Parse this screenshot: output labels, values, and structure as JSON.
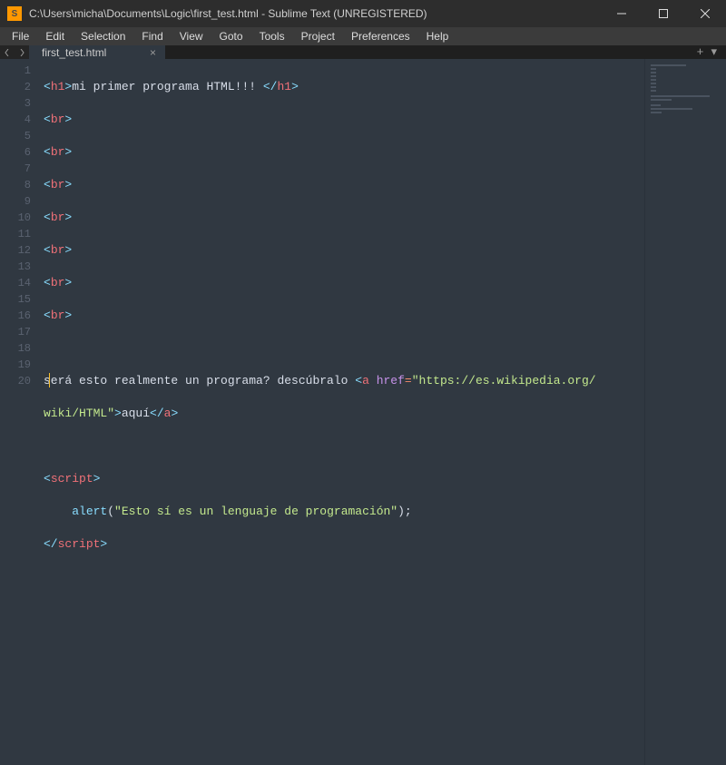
{
  "window": {
    "title": "C:\\Users\\micha\\Documents\\Logic\\first_test.html - Sublime Text (UNREGISTERED)"
  },
  "menu": {
    "items": [
      "File",
      "Edit",
      "Selection",
      "Find",
      "View",
      "Goto",
      "Tools",
      "Project",
      "Preferences",
      "Help"
    ]
  },
  "tabs": {
    "active": {
      "label": "first_test.html"
    }
  },
  "gutter": {
    "lines": [
      "1",
      "2",
      "3",
      "4",
      "5",
      "6",
      "7",
      "8",
      "9",
      "10",
      "11",
      "12",
      "13",
      "14",
      "15",
      "16",
      "17",
      "18",
      "19",
      "20"
    ]
  },
  "code": {
    "l1_tag": "h1",
    "l1_text": "mi primer programa HTML!!! ",
    "br": "br",
    "l10_text": "será esto realmente un programa? descúbralo ",
    "l10_a": "a",
    "l10_href_attr": "href",
    "l10_href_val": "\"https://es.wikipedia.org/",
    "l10b_text": "wiki/HTML\"",
    "l10b_linktext": "aquí",
    "l13_script": "script",
    "l14_fn": "alert",
    "l14_str": "\"Esto sí es un lenguaje de programación\""
  }
}
